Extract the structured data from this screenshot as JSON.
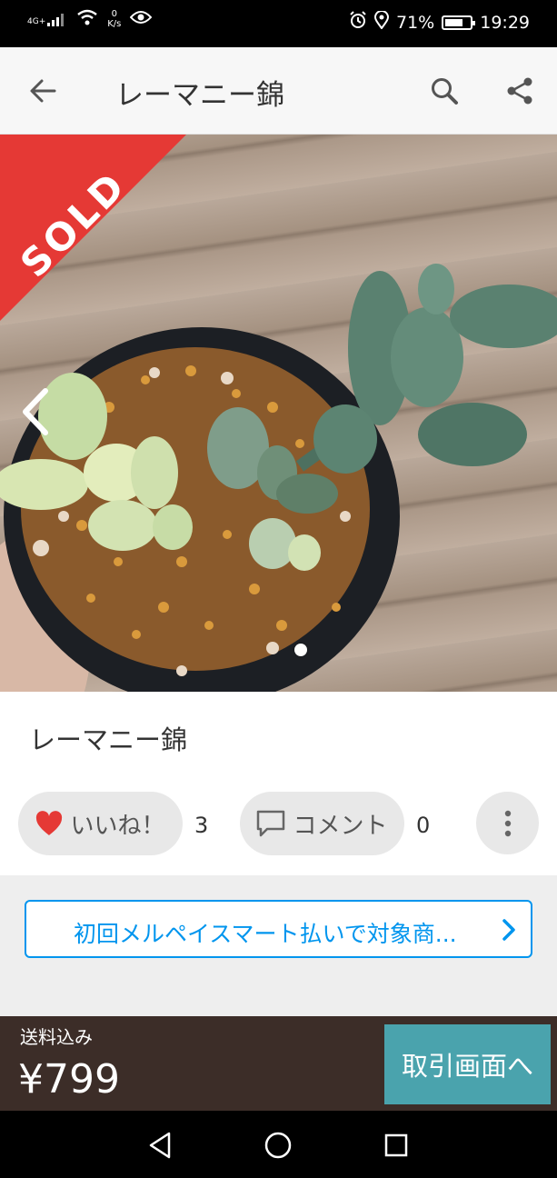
{
  "status_bar": {
    "network_type": "4G+",
    "speed_value": "0",
    "speed_unit": "K/s",
    "battery": "71%",
    "battery_level": 0.71,
    "time": "19:29"
  },
  "app_bar": {
    "title": "レーマニー錦",
    "back_icon": "arrow-left-icon",
    "search_icon": "search-icon",
    "share_icon": "share-icon"
  },
  "photo": {
    "sold_label": "SOLD",
    "sold_color": "#e53935",
    "prev_icon": "chevron-left-icon",
    "page_count": 1,
    "current_page": 1
  },
  "item": {
    "name": "レーマニー錦",
    "like_label": "いいね！",
    "like_count": "3",
    "comment_label": "コメント",
    "comment_count": "0",
    "heart_color": "#e53935"
  },
  "promo": {
    "text": "初回メルペイスマート払いで対象商...",
    "accent": "#0095ee"
  },
  "bottom_bar": {
    "shipping_label": "送料込み",
    "price": "¥799",
    "cta_label": "取引画面へ",
    "cta_color": "#4aa3ad"
  }
}
